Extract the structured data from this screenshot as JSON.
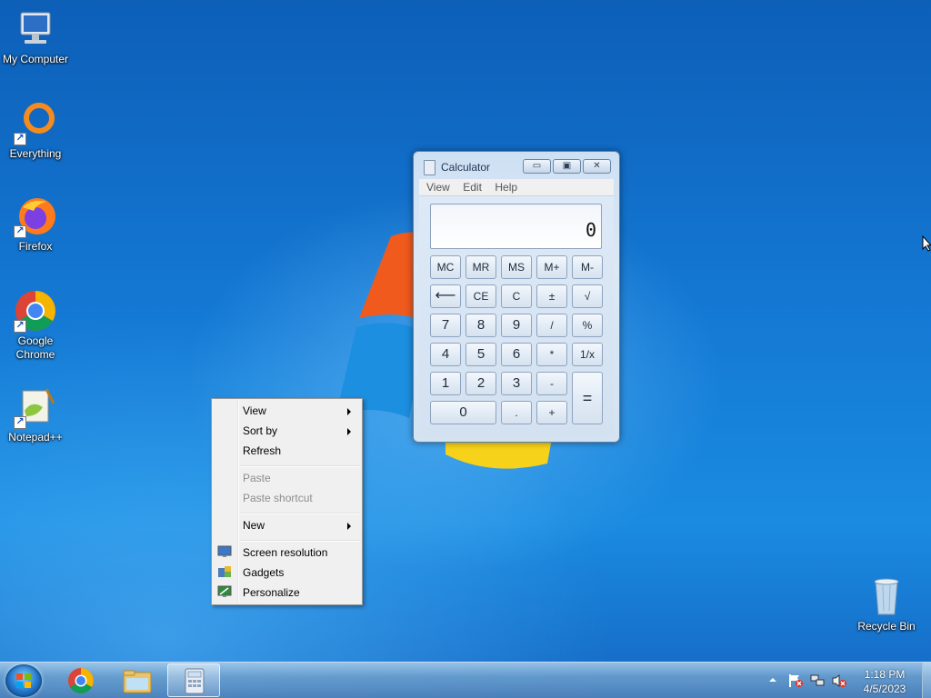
{
  "desktop": {
    "icons": [
      {
        "label": "My Computer",
        "icon": "computer-icon"
      },
      {
        "label": "Everything",
        "icon": "everything-icon"
      },
      {
        "label": "Firefox",
        "icon": "firefox-icon"
      },
      {
        "label": "Google Chrome",
        "icon": "chrome-icon"
      },
      {
        "label": "Notepad++",
        "icon": "notepadpp-icon"
      }
    ],
    "recycle_bin": {
      "label": "Recycle Bin",
      "icon": "recycle-bin-icon"
    }
  },
  "calculator": {
    "title": "Calculator",
    "menu": [
      "View",
      "Edit",
      "Help"
    ],
    "display": "0",
    "keys": {
      "mc": "MC",
      "mr": "MR",
      "ms": "MS",
      "mplus": "M+",
      "mminus": "M-",
      "back": "⟵",
      "ce": "CE",
      "c": "C",
      "plusminus": "±",
      "sqrt": "√",
      "k7": "7",
      "k8": "8",
      "k9": "9",
      "div": "/",
      "pct": "%",
      "k4": "4",
      "k5": "5",
      "k6": "6",
      "mul": "*",
      "recip": "1/x",
      "k1": "1",
      "k2": "2",
      "k3": "3",
      "sub": "-",
      "eq": "=",
      "k0": "0",
      "dot": ".",
      "add": "+"
    }
  },
  "context_menu": {
    "items": [
      {
        "label": "View",
        "submenu": true
      },
      {
        "label": "Sort by",
        "submenu": true
      },
      {
        "label": "Refresh"
      },
      {
        "label": "Paste",
        "disabled": true
      },
      {
        "label": "Paste shortcut",
        "disabled": true
      },
      {
        "label": "New",
        "submenu": true
      },
      {
        "label": "Screen resolution",
        "icon": "screen-resolution-icon"
      },
      {
        "label": "Gadgets",
        "icon": "gadgets-icon"
      },
      {
        "label": "Personalize",
        "icon": "personalize-icon"
      }
    ]
  },
  "taskbar": {
    "start": "start-orb-icon",
    "pinned": [
      "chrome-icon",
      "explorer-icon",
      "calculator-icon"
    ],
    "tray_icons": [
      "show-hidden-icons-icon",
      "action-center-icon",
      "network-icon",
      "volume-muted-icon"
    ],
    "clock": {
      "time": "1:18 PM",
      "date": "4/5/2023"
    }
  },
  "colors": {
    "desktop_blue": "#1479d4",
    "taskbar": "#6ea0cd",
    "menu_bg": "#f0f0f0"
  }
}
